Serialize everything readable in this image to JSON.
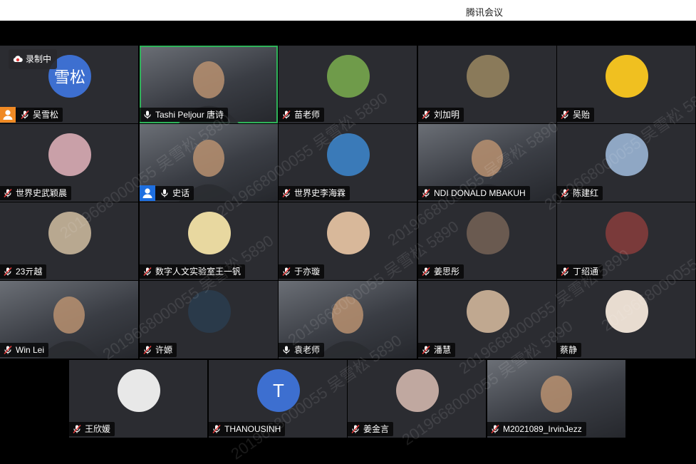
{
  "window": {
    "title": "腾讯会议"
  },
  "recording": {
    "label": "录制中"
  },
  "watermark": "2019668000055 吴雪松 5890",
  "participants": [
    {
      "name": "吴雪松",
      "avatar_text": "雪松",
      "avatar_color": "#3d6fd0",
      "host": true
    },
    {
      "name": "Tashi Peljour 唐诗",
      "speaking": true,
      "video": true
    },
    {
      "name": "苗老师",
      "avatar_color": "#6f9b4a"
    },
    {
      "name": "刘加明",
      "avatar_color": "#8a7a5a"
    },
    {
      "name": "吴贻",
      "avatar_color": "#f0c020"
    },
    {
      "name": "世界史武颖晨",
      "avatar_color": "#c9a0a8"
    },
    {
      "name": "史话",
      "video": true,
      "cohost": true
    },
    {
      "name": "世界史李海霖",
      "avatar_color": "#3a7ab8"
    },
    {
      "name": "NDI DONALD MBAKUH",
      "video": true
    },
    {
      "name": "陈建红",
      "avatar_color": "#8fa7c4"
    },
    {
      "name": "23亓越",
      "avatar_color": "#b8a890"
    },
    {
      "name": "数字人文实验室王一钒",
      "avatar_color": "#e8d8a0"
    },
    {
      "name": "于亦璇",
      "avatar_color": "#d8b89a"
    },
    {
      "name": "姜思彤",
      "avatar_color": "#6a5a50"
    },
    {
      "name": "丁绍通",
      "avatar_color": "#7a3a3a"
    },
    {
      "name": "Win Lei",
      "video": true
    },
    {
      "name": "许嫄",
      "avatar_color": "#2a3a4a"
    },
    {
      "name": "袁老师",
      "video": true
    },
    {
      "name": "潘慧",
      "avatar_color": "#c0a890"
    },
    {
      "name": "蔡静",
      "avatar_color": "#e8dcd0",
      "no_mic": true
    },
    {
      "name": "王欣媛",
      "avatar_color": "#e8e8e8"
    },
    {
      "name": "THANOUSINH",
      "avatar_text": "T",
      "avatar_color": "#3d6fd0"
    },
    {
      "name": "姜金言",
      "avatar_color": "#c0a8a0"
    },
    {
      "name": "M2021089_IrvinJezz",
      "video": true
    }
  ]
}
